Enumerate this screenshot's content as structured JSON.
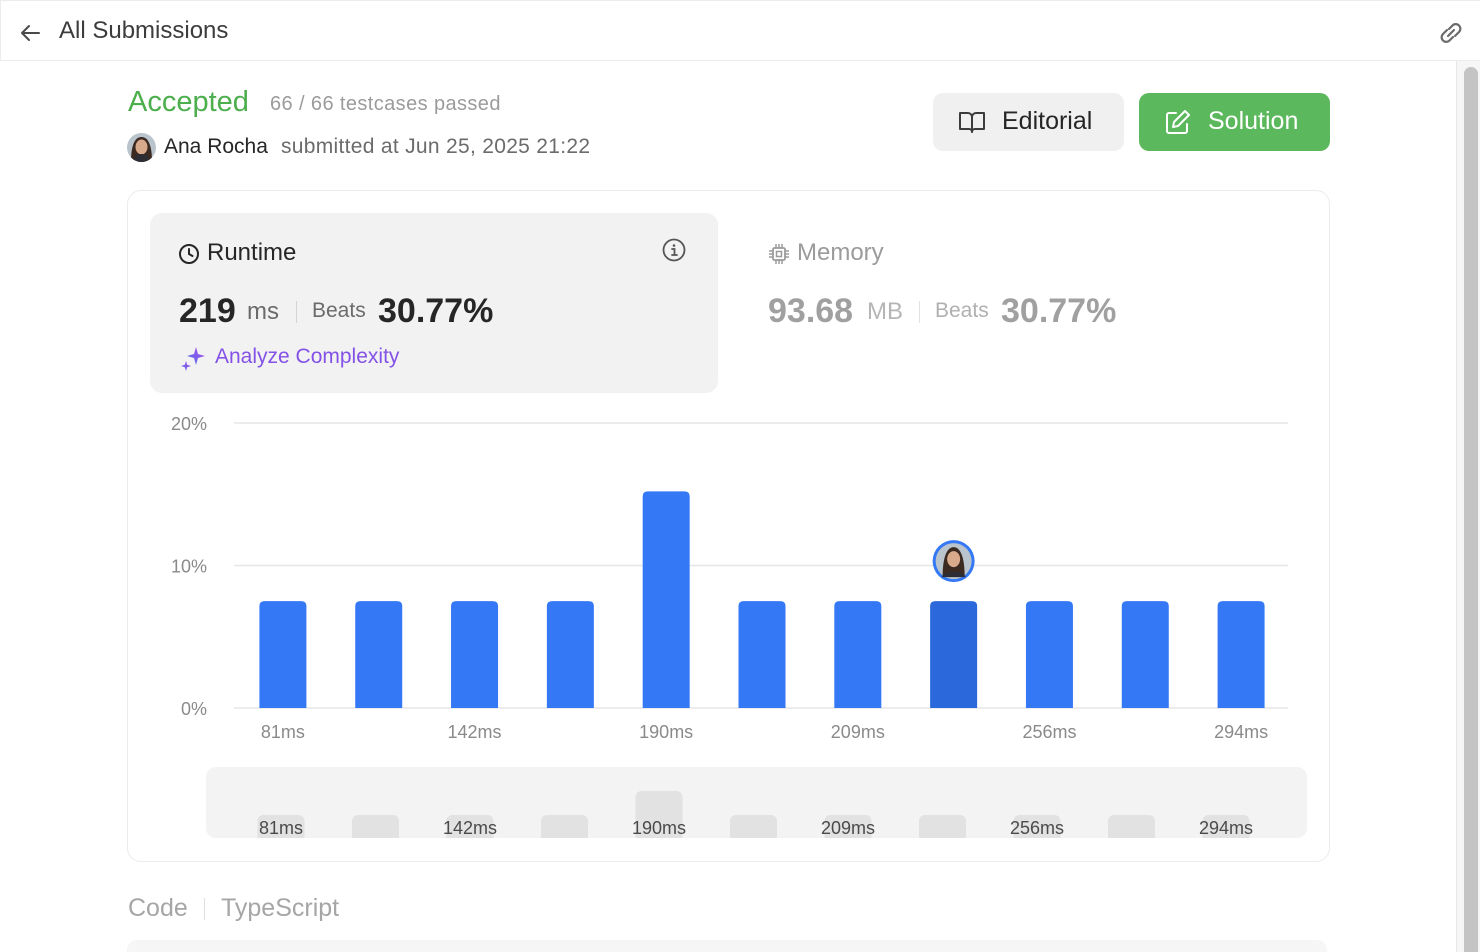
{
  "header": {
    "title": "All Submissions"
  },
  "submission": {
    "status": "Accepted",
    "testcases": "66 / 66 testcases passed",
    "user_name": "Ana Rocha",
    "submitted_text": "submitted at Jun 25, 2025 21:22"
  },
  "buttons": {
    "editorial": "Editorial",
    "solution": "Solution"
  },
  "runtime": {
    "label": "Runtime",
    "value": "219",
    "unit": "ms",
    "beats_label": "Beats",
    "beats_value": "30.77%",
    "analyze_label": "Analyze Complexity"
  },
  "memory": {
    "label": "Memory",
    "value": "93.68",
    "unit": "MB",
    "beats_label": "Beats",
    "beats_value": "30.77%"
  },
  "code_section": {
    "label": "Code",
    "language": "TypeScript"
  },
  "colors": {
    "accepted": "#4cae4c",
    "solution_button": "#5cb85c",
    "bar": "#3478f6",
    "bar_highlight": "#2a68db",
    "analyze": "#8452e6"
  },
  "icons": [
    "back-arrow-icon",
    "link-icon",
    "book-icon",
    "edit-icon",
    "clock-icon",
    "info-icon",
    "sparkle-icon",
    "chip-icon"
  ],
  "chart_data": {
    "type": "bar",
    "categories": [
      "81ms",
      "",
      "142ms",
      "",
      "190ms",
      "",
      "209ms",
      "",
      "256ms",
      "",
      "294ms"
    ],
    "values": [
      7.5,
      7.5,
      7.5,
      7.5,
      15.2,
      7.5,
      7.5,
      7.5,
      7.5,
      7.5,
      7.5
    ],
    "highlight_index": 7,
    "y_ticks": [
      "0%",
      "10%",
      "20%"
    ],
    "ylim": [
      0,
      20
    ],
    "grid": true,
    "overview_labels": [
      "81ms",
      "142ms",
      "190ms",
      "209ms",
      "256ms",
      "294ms"
    ]
  }
}
